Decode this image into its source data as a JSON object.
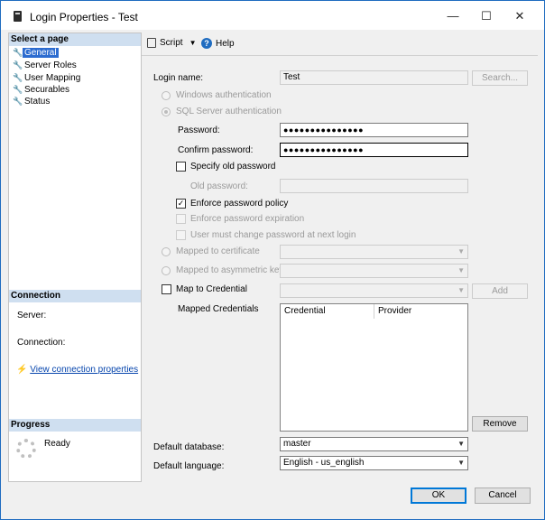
{
  "window": {
    "title": "Login Properties - Test",
    "controls": [
      "—",
      "☐",
      "✕"
    ]
  },
  "left": {
    "select_page_header": "Select a page",
    "pages": [
      {
        "label": "General",
        "selected": true
      },
      {
        "label": "Server Roles",
        "selected": false
      },
      {
        "label": "User Mapping",
        "selected": false
      },
      {
        "label": "Securables",
        "selected": false
      },
      {
        "label": "Status",
        "selected": false
      }
    ],
    "connection_header": "Connection",
    "server_label": "Server:",
    "connection_label": "Connection:",
    "view_connection_link": "View connection properties",
    "progress_header": "Progress",
    "progress_status": "Ready"
  },
  "toolbar": {
    "script_label": "Script",
    "help_label": "Help"
  },
  "general": {
    "login_name_label": "Login name:",
    "login_name_value": "Test",
    "search_button": "Search...",
    "windows_auth_label": "Windows authentication",
    "sql_auth_label": "SQL Server authentication",
    "password_label": "Password:",
    "password_value": "●●●●●●●●●●●●●●●",
    "confirm_password_label": "Confirm password:",
    "confirm_password_value": "●●●●●●●●●●●●●●●",
    "specify_old_password_label": "Specify old password",
    "old_password_label": "Old password:",
    "enforce_policy_label": "Enforce password policy",
    "enforce_expiration_label": "Enforce password expiration",
    "must_change_label": "User must change password at next login",
    "mapped_cert_label": "Mapped to certificate",
    "mapped_asym_label": "Mapped to asymmetric key",
    "map_credential_label": "Map to Credential",
    "add_button": "Add",
    "mapped_credentials_label": "Mapped Credentials",
    "credentials_columns": [
      "Credential",
      "Provider"
    ],
    "remove_button": "Remove",
    "default_database_label": "Default database:",
    "default_database_value": "master",
    "default_language_label": "Default language:",
    "default_language_value": "English - us_english"
  },
  "footer": {
    "ok_button": "OK",
    "cancel_button": "Cancel"
  },
  "colors": {
    "selected_bg": "#2c6cd0",
    "section_header_bg": "#cfdff0",
    "focus_border": "#0078d7"
  }
}
